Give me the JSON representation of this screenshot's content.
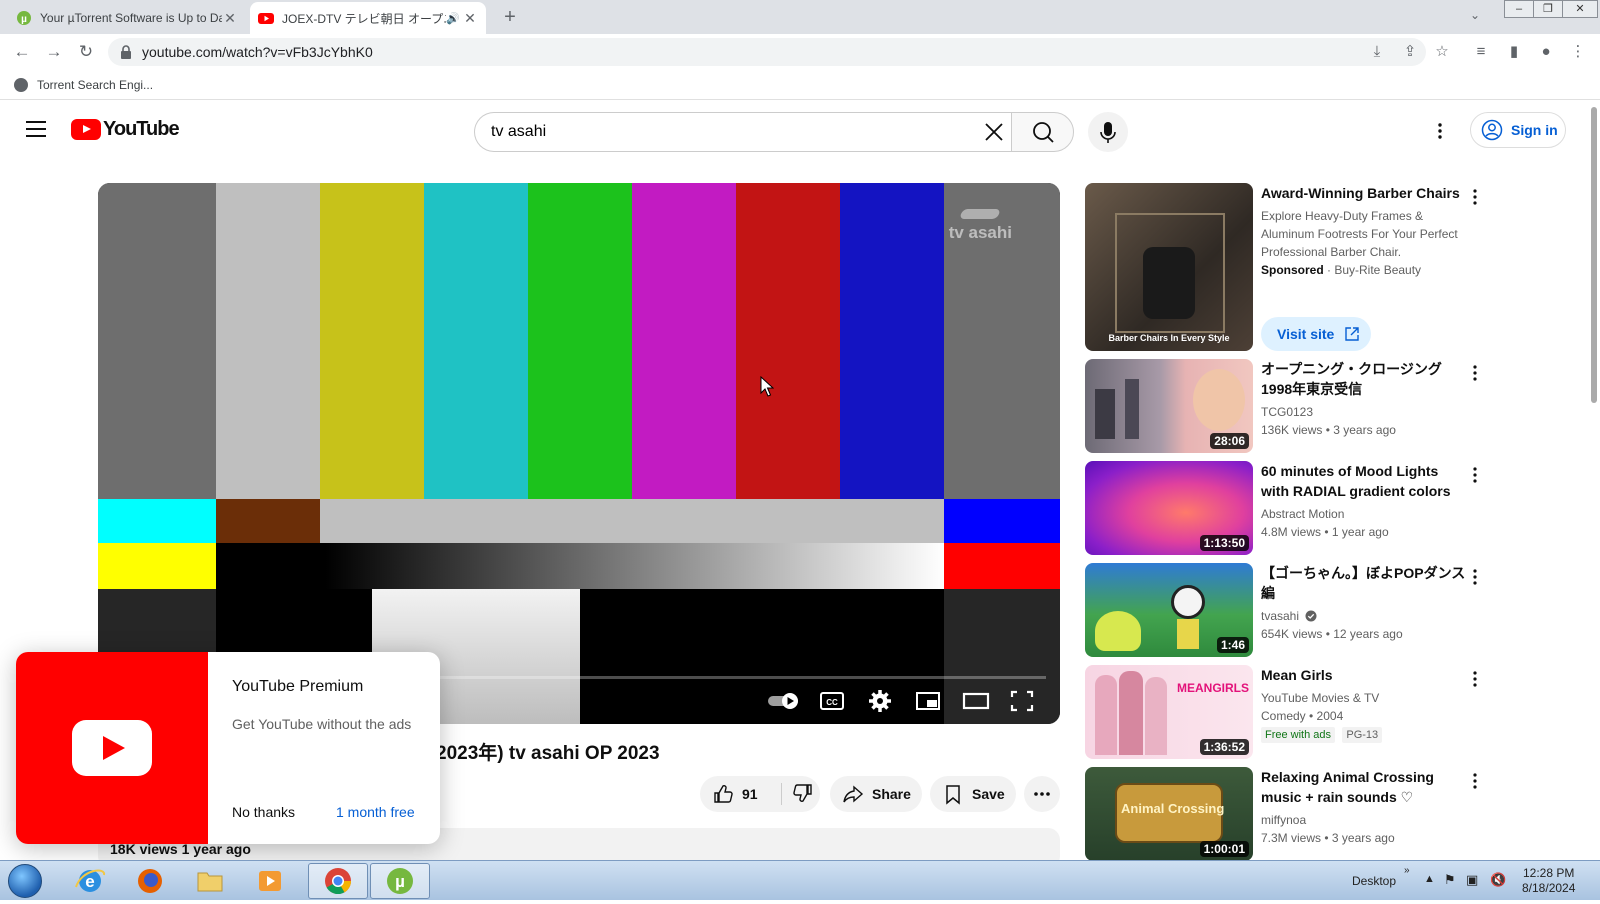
{
  "browser": {
    "tabs": [
      {
        "title": "Your µTorrent Software is Up to Date",
        "active": false
      },
      {
        "title": "JOEX-DTV テレビ朝日 オープニング",
        "active": true
      }
    ],
    "new_tab_label": "+",
    "url": "youtube.com/watch?v=vFb3JcYbhK0",
    "bookmarks": [
      {
        "label": "Torrent Search Engi..."
      }
    ]
  },
  "youtube": {
    "logo_text": "YouTube",
    "search_value": "tv asahi",
    "sign_in_label": "Sign in",
    "player": {
      "watermark": "tv asahi"
    },
    "video": {
      "title_visible": "2023年) tv asahi OP 2023",
      "likes": "91",
      "share_label": "Share",
      "save_label": "Save",
      "views": "18K views",
      "age": "1 year ago"
    },
    "sidebar": [
      {
        "title": "Award-Winning Barber Chairs",
        "desc": "Explore Heavy-Duty Frames & Aluminum Footrests For Your Perfect Professional Barber Chair.",
        "sponsored": "Sponsored",
        "advertiser": "Buy-Rite Beauty",
        "thumb_caption": "Barber Chairs In Every Style",
        "cta": "Visit site"
      },
      {
        "title": "オープニング・クロージング 1998年東京受信",
        "channel": "TCG0123",
        "views": "136K views",
        "age": "3 years ago",
        "duration": "28:06"
      },
      {
        "title": "60 minutes of Mood Lights with RADIAL gradient colors -...",
        "channel": "Abstract Motion",
        "views": "4.8M views",
        "age": "1 year ago",
        "duration": "1:13:50"
      },
      {
        "title": "【ゴーちゃん。】ぼよPOPダンス編",
        "channel": "tvasahi",
        "verified": true,
        "views": "654K views",
        "age": "12 years ago",
        "duration": "1:46"
      },
      {
        "title": "Mean Girls",
        "channel": "YouTube Movies & TV",
        "meta": "Comedy • 2004",
        "badge_free": "Free with ads",
        "badge_rating": "PG-13",
        "duration": "1:36:52",
        "thumb_text": "MEANGIRLS"
      },
      {
        "title": "Relaxing Animal Crossing music + rain sounds ♡",
        "channel": "miffynoa",
        "views": "7.3M views",
        "age": "3 years ago",
        "duration": "1:00:01",
        "thumb_text": "Animal Crossing"
      }
    ],
    "premium_popup": {
      "title": "YouTube Premium",
      "desc": "Get YouTube without the ads",
      "decline": "No thanks",
      "accept": "1 month free"
    }
  },
  "taskbar": {
    "desktop_label": "Desktop",
    "time": "12:28 PM",
    "date": "8/18/2024"
  },
  "colors": {
    "yt_red": "#ff0000",
    "link_blue": "#065fd4"
  }
}
